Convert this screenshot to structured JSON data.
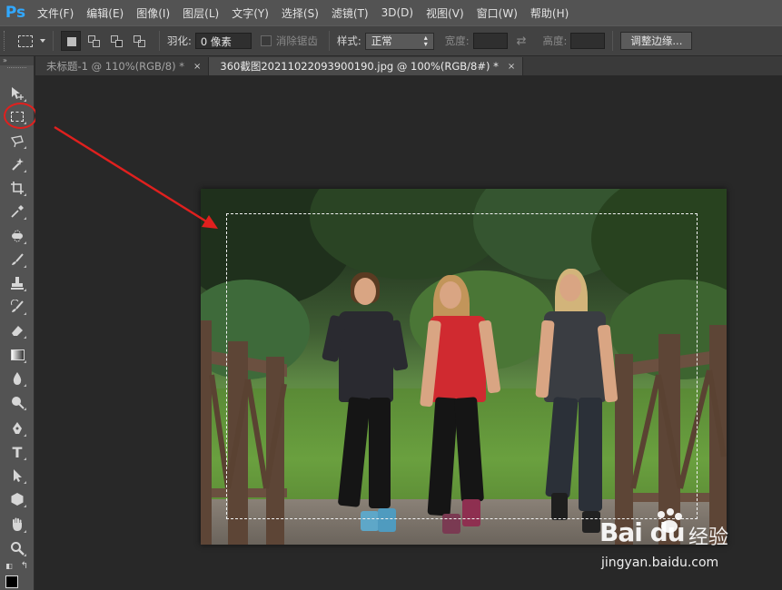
{
  "app": {
    "logo": "Ps"
  },
  "menu": [
    "文件(F)",
    "编辑(E)",
    "图像(I)",
    "图层(L)",
    "文字(Y)",
    "选择(S)",
    "滤镜(T)",
    "3D(D)",
    "视图(V)",
    "窗口(W)",
    "帮助(H)"
  ],
  "options": {
    "feather_label": "羽化:",
    "feather_value": "0 像素",
    "antialias_label": "消除锯齿",
    "style_label": "样式:",
    "style_value": "正常",
    "width_label": "宽度:",
    "height_label": "高度:",
    "refine_edge_label": "调整边缘..."
  },
  "tabs": [
    {
      "title": "未标题-1 @ 110%(RGB/8) *",
      "close": "×",
      "active": false
    },
    {
      "title": "360截图20211022093900190.jpg @ 100%(RGB/8#) *",
      "close": "×",
      "active": true
    }
  ],
  "tools": [
    "move-tool",
    "rectangular-marquee-tool",
    "lasso-tool",
    "magic-wand-tool",
    "crop-tool",
    "eyedropper-tool",
    "spot-healing-brush-tool",
    "brush-tool",
    "clone-stamp-tool",
    "history-brush-tool",
    "eraser-tool",
    "gradient-tool",
    "blur-tool",
    "dodge-tool",
    "pen-tool",
    "type-tool",
    "path-selection-tool",
    "shape-tool",
    "hand-tool",
    "zoom-tool"
  ],
  "toolpanel": {
    "collapse": "»",
    "type_tool_glyph": "T"
  },
  "watermark": {
    "logo": "Bai du",
    "cn": "经验",
    "url": "jingyan.baidu.com"
  },
  "colors": {
    "annotation_red": "#e0201e",
    "menu_bg": "#535353",
    "canvas_bg": "#282828"
  }
}
